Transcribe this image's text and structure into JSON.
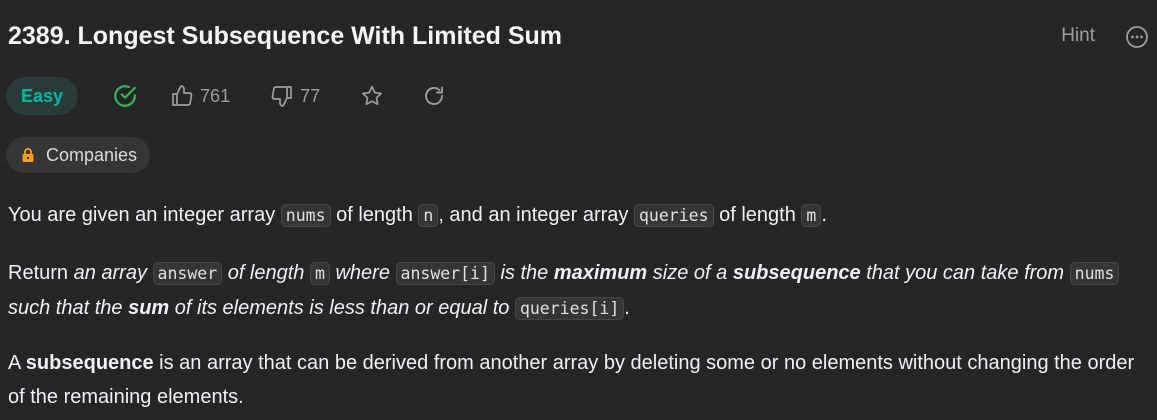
{
  "problem": {
    "title": "2389. Longest Subsequence With Limited Sum",
    "hint_label": "Hint",
    "difficulty": "Easy",
    "likes": "761",
    "dislikes": "77",
    "companies_label": "Companies"
  },
  "icons": {
    "solved": "check-circle-icon",
    "like": "thumbs-up-icon",
    "dislike": "thumbs-down-icon",
    "favorite": "star-icon",
    "share": "refresh-icon",
    "more": "ellipsis-icon",
    "lock": "lock-icon"
  },
  "colors": {
    "easy": "#00b8a3",
    "solved": "#2cbb5d",
    "lock": "#ffa116"
  },
  "p1": {
    "t1": "You are given an integer array ",
    "c1": "nums",
    "t2": " of length ",
    "c2": "n",
    "t3": ", and an integer array ",
    "c3": "queries",
    "t4": " of length ",
    "c4": "m",
    "t5": "."
  },
  "p2": {
    "t1": "Return ",
    "e1": "an array ",
    "c1": "answer",
    "e2": " of length ",
    "c2": "m",
    "e3": " where ",
    "c3": "answer[i]",
    "e4": " is the ",
    "b1": "maximum",
    "e5": " size of a ",
    "b2": "subsequence",
    "e6": " that you can take from ",
    "c4": "nums",
    "e7": " such that the ",
    "b3": "sum",
    "e8": " of its elements is less than or equal to ",
    "c5": "queries[i]",
    "t2": "."
  },
  "p3": {
    "t1": "A ",
    "b1": "subsequence",
    "t2": " is an array that can be derived from another array by deleting some or no elements without changing the order of the remaining elements."
  }
}
